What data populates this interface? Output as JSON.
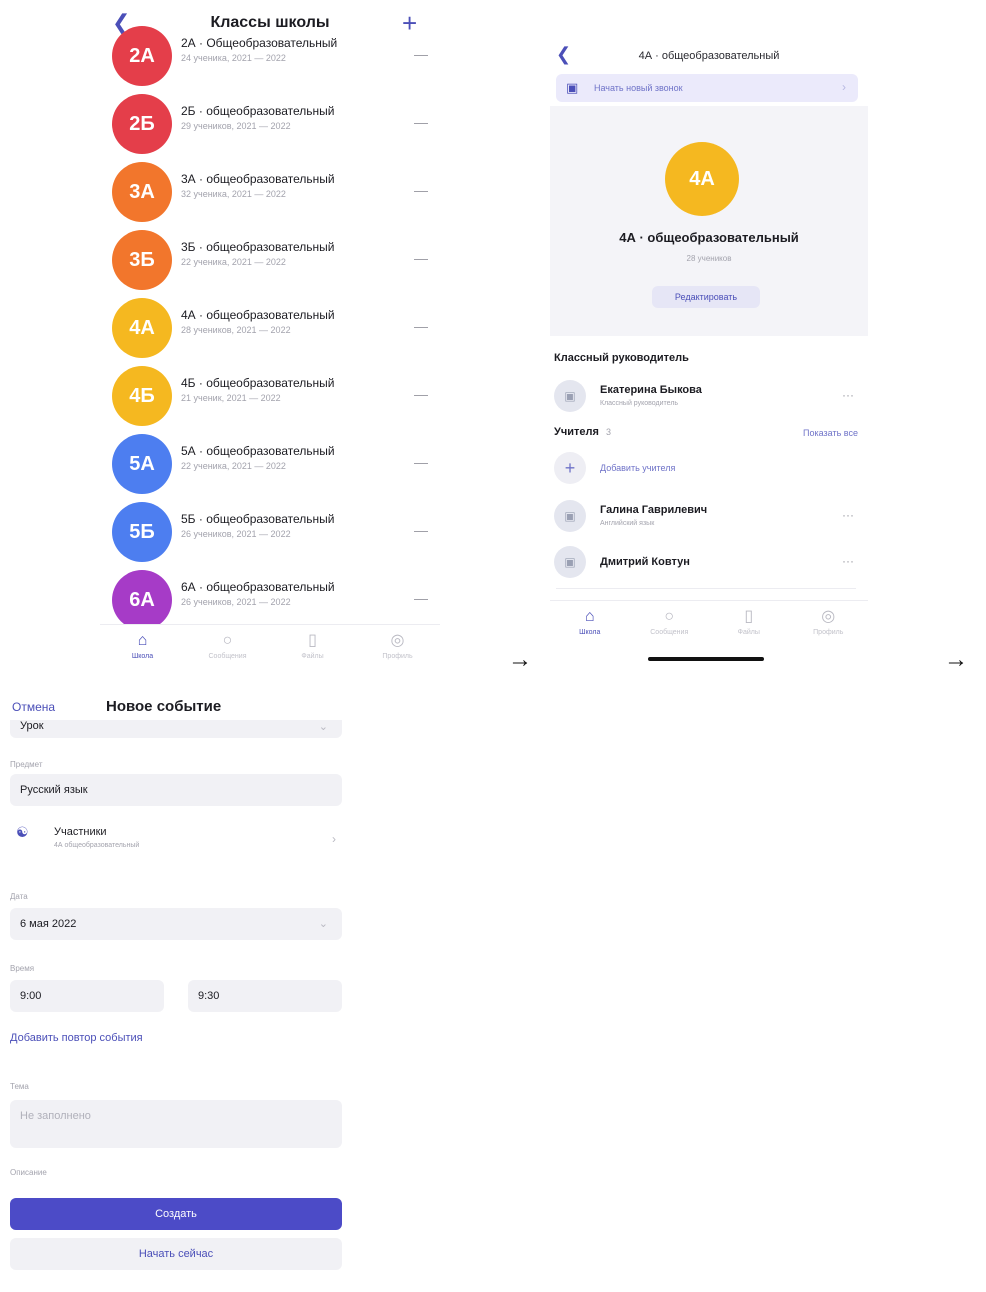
{
  "screen1": {
    "back_icon": "chevron-left-icon",
    "title": "Классы школы",
    "add_icon": "plus-icon",
    "classes": [
      {
        "badge": "2A",
        "name": "2А · Общеобразовательный",
        "meta": "24 ученика, 2021 — 2022",
        "color": "#e43e4a"
      },
      {
        "badge": "2Б",
        "name": "2Б · общеобразовательный",
        "meta": "29 учеников, 2021 — 2022",
        "color": "#e43e4a"
      },
      {
        "badge": "3A",
        "name": "3А · общеобразовательный",
        "meta": "32 ученика, 2021 — 2022",
        "color": "#f2762c"
      },
      {
        "badge": "3Б",
        "name": "3Б · общеобразовательный",
        "meta": "22 ученика, 2021 — 2022",
        "color": "#f2762c"
      },
      {
        "badge": "4A",
        "name": "4А · общеобразовательный",
        "meta": "28 учеников, 2021 — 2022",
        "color": "#f5b820"
      },
      {
        "badge": "4Б",
        "name": "4Б · общеобразовательный",
        "meta": "21 ученик, 2021 — 2022",
        "color": "#f5b820"
      },
      {
        "badge": "5A",
        "name": "5А · общеобразовательный",
        "meta": "22 ученика, 2021 — 2022",
        "color": "#4d7ef0"
      },
      {
        "badge": "5Б",
        "name": "5Б · общеобразовательный",
        "meta": "26 учеников, 2021 — 2022",
        "color": "#4d7ef0"
      },
      {
        "badge": "6A",
        "name": "6А · общеобразовательный",
        "meta": "26 учеников, 2021 — 2022",
        "color": "#a63bc7"
      }
    ],
    "tabs": [
      {
        "icon": "school-icon",
        "label": "Школа"
      },
      {
        "icon": "chat-icon",
        "label": "Сообщения"
      },
      {
        "icon": "file-icon",
        "label": "Файлы"
      },
      {
        "icon": "profile-icon",
        "label": "Профиль"
      }
    ]
  },
  "arrows": [
    "→",
    "→"
  ],
  "screen2": {
    "back_icon": "chevron-left-icon",
    "title": "4А · общеобразовательный",
    "call_label": "Начать новый звонок",
    "badge": "4A",
    "class_name": "4А · общеобразовательный",
    "students": "28 учеников",
    "edit_label": "Редактировать",
    "homeroom_heading": "Классный руководитель",
    "homeroom": {
      "name": "Екатерина Быкова",
      "role": "Классный руководитель"
    },
    "teachers_heading": "Учителя",
    "teachers_count": "3",
    "show_all": "Показать все",
    "add_teacher": "Добавить учителя",
    "teachers": [
      {
        "name": "Галина Гаврилевич",
        "role": "Английский язык"
      },
      {
        "name": "Дмитрий Ковтун",
        "role": ""
      }
    ],
    "tabs": [
      {
        "icon": "school-icon",
        "label": "Школа"
      },
      {
        "icon": "chat-icon",
        "label": "Сообщения"
      },
      {
        "icon": "file-icon",
        "label": "Файлы"
      },
      {
        "icon": "profile-icon",
        "label": "Профиль"
      }
    ]
  },
  "screen3": {
    "cancel": "Отмена",
    "title": "Новое событие",
    "type_value": "Урок",
    "subject_label": "Предмет",
    "subject_value": "Русский язык",
    "participants_label": "Участники",
    "participants_value": "4А общеобразовательный",
    "date_label": "Дата",
    "date_value": "6 мая 2022",
    "time_label": "Время",
    "time_start": "9:00",
    "time_end": "9:30",
    "repeat_link": "Добавить повтор события",
    "topic_label": "Тема",
    "topic_placeholder": "Не заполнено",
    "description_label": "Описание",
    "create_button": "Создать",
    "start_now_button": "Начать сейчас"
  }
}
